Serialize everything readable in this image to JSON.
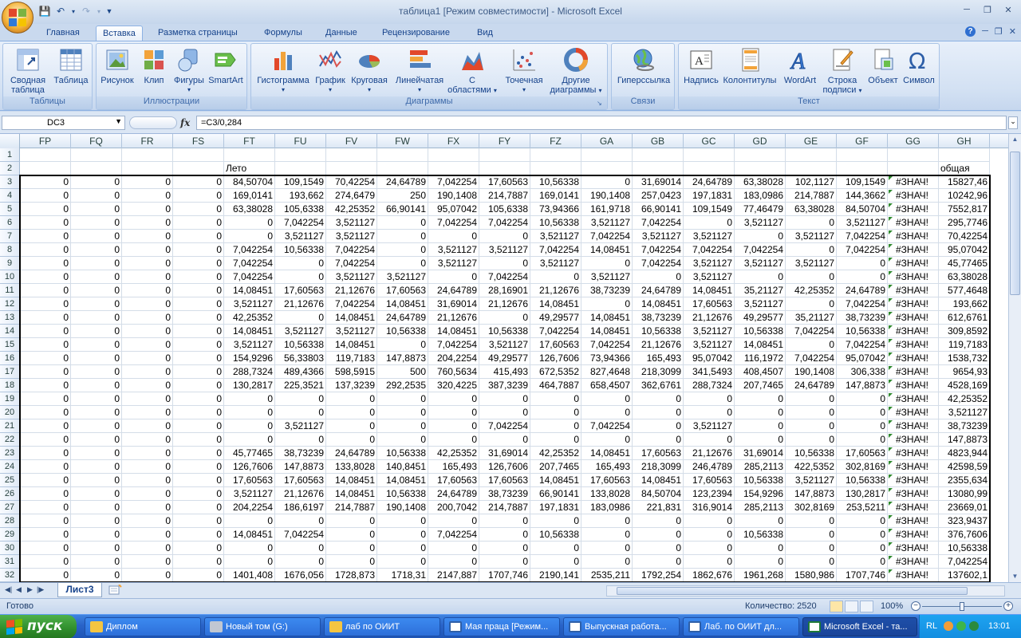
{
  "window": {
    "title": "таблица1  [Режим совместимости] - Microsoft Excel"
  },
  "ribbon_tabs": [
    "Главная",
    "Вставка",
    "Разметка страницы",
    "Формулы",
    "Данные",
    "Рецензирование",
    "Вид"
  ],
  "active_tab": "Вставка",
  "ribbon": {
    "groups": [
      {
        "label": "Таблицы",
        "buttons": [
          "Сводная таблица",
          "Таблица"
        ]
      },
      {
        "label": "Иллюстрации",
        "buttons": [
          "Рисунок",
          "Клип",
          "Фигуры",
          "SmartArt"
        ]
      },
      {
        "label": "Диаграммы",
        "buttons": [
          "Гистограмма",
          "График",
          "Круговая",
          "Линейчатая",
          "С областями",
          "Точечная",
          "Другие диаграммы"
        ]
      },
      {
        "label": "Связи",
        "buttons": [
          "Гиперссылка"
        ]
      },
      {
        "label": "Текст",
        "buttons": [
          "Надпись",
          "Колонтитулы",
          "WordArt",
          "Строка подписи",
          "Объект",
          "Символ"
        ]
      }
    ]
  },
  "formula_bar": {
    "name_box": "DC3",
    "fx": "fx",
    "formula": "=C3/0,284"
  },
  "sheet": {
    "columns": [
      "FP",
      "FQ",
      "FR",
      "FS",
      "FT",
      "FU",
      "FV",
      "FW",
      "FX",
      "FY",
      "FZ",
      "GA",
      "GB",
      "GC",
      "GD",
      "GE",
      "GF",
      "GG",
      "GH"
    ],
    "row2": {
      "FT": "Лето",
      "GH": "общая"
    },
    "rows": [
      {
        "n": "1",
        "c": [
          "",
          "",
          "",
          "",
          "",
          "",
          "",
          "",
          "",
          "",
          "",
          "",
          "",
          "",
          "",
          "",
          "",
          "",
          ""
        ]
      },
      {
        "n": "2",
        "c": [
          "",
          "",
          "",
          "",
          "Лето",
          "",
          "",
          "",
          "",
          "",
          "",
          "",
          "",
          "",
          "",
          "",
          "",
          "",
          "общая"
        ]
      },
      {
        "n": "3",
        "c": [
          "0",
          "0",
          "0",
          "0",
          "84,50704",
          "109,1549",
          "70,42254",
          "24,64789",
          "7,042254",
          "17,60563",
          "10,56338",
          "0",
          "31,69014",
          "24,64789",
          "63,38028",
          "102,1127",
          "109,1549",
          "#ЗНАЧ!",
          "15827,46"
        ]
      },
      {
        "n": "4",
        "c": [
          "0",
          "0",
          "0",
          "0",
          "169,0141",
          "193,662",
          "274,6479",
          "250",
          "190,1408",
          "214,7887",
          "169,0141",
          "190,1408",
          "257,0423",
          "197,1831",
          "183,0986",
          "214,7887",
          "144,3662",
          "#ЗНАЧ!",
          "10242,96"
        ]
      },
      {
        "n": "5",
        "c": [
          "0",
          "0",
          "0",
          "0",
          "63,38028",
          "105,6338",
          "42,25352",
          "66,90141",
          "95,07042",
          "105,6338",
          "73,94366",
          "161,9718",
          "66,90141",
          "109,1549",
          "77,46479",
          "63,38028",
          "84,50704",
          "#ЗНАЧ!",
          "7552,817"
        ]
      },
      {
        "n": "6",
        "c": [
          "0",
          "0",
          "0",
          "0",
          "0",
          "7,042254",
          "3,521127",
          "0",
          "7,042254",
          "7,042254",
          "10,56338",
          "3,521127",
          "7,042254",
          "0",
          "3,521127",
          "0",
          "3,521127",
          "#ЗНАЧ!",
          "295,7746"
        ]
      },
      {
        "n": "7",
        "c": [
          "0",
          "0",
          "0",
          "0",
          "0",
          "3,521127",
          "3,521127",
          "0",
          "0",
          "0",
          "3,521127",
          "7,042254",
          "3,521127",
          "3,521127",
          "0",
          "3,521127",
          "7,042254",
          "#ЗНАЧ!",
          "70,42254"
        ]
      },
      {
        "n": "8",
        "c": [
          "0",
          "0",
          "0",
          "0",
          "7,042254",
          "10,56338",
          "7,042254",
          "0",
          "3,521127",
          "3,521127",
          "7,042254",
          "14,08451",
          "7,042254",
          "7,042254",
          "7,042254",
          "0",
          "7,042254",
          "#ЗНАЧ!",
          "95,07042"
        ]
      },
      {
        "n": "9",
        "c": [
          "0",
          "0",
          "0",
          "0",
          "7,042254",
          "0",
          "7,042254",
          "0",
          "3,521127",
          "0",
          "3,521127",
          "0",
          "7,042254",
          "3,521127",
          "3,521127",
          "3,521127",
          "0",
          "#ЗНАЧ!",
          "45,77465"
        ]
      },
      {
        "n": "10",
        "c": [
          "0",
          "0",
          "0",
          "0",
          "7,042254",
          "0",
          "3,521127",
          "3,521127",
          "0",
          "7,042254",
          "0",
          "3,521127",
          "0",
          "3,521127",
          "0",
          "0",
          "0",
          "#ЗНАЧ!",
          "63,38028"
        ]
      },
      {
        "n": "11",
        "c": [
          "0",
          "0",
          "0",
          "0",
          "14,08451",
          "17,60563",
          "21,12676",
          "17,60563",
          "24,64789",
          "28,16901",
          "21,12676",
          "38,73239",
          "24,64789",
          "14,08451",
          "35,21127",
          "42,25352",
          "24,64789",
          "#ЗНАЧ!",
          "577,4648"
        ]
      },
      {
        "n": "12",
        "c": [
          "0",
          "0",
          "0",
          "0",
          "3,521127",
          "21,12676",
          "7,042254",
          "14,08451",
          "31,69014",
          "21,12676",
          "14,08451",
          "0",
          "14,08451",
          "17,60563",
          "3,521127",
          "0",
          "7,042254",
          "#ЗНАЧ!",
          "193,662"
        ]
      },
      {
        "n": "13",
        "c": [
          "0",
          "0",
          "0",
          "0",
          "42,25352",
          "0",
          "14,08451",
          "24,64789",
          "21,12676",
          "0",
          "49,29577",
          "14,08451",
          "38,73239",
          "21,12676",
          "49,29577",
          "35,21127",
          "38,73239",
          "#ЗНАЧ!",
          "612,6761"
        ]
      },
      {
        "n": "14",
        "c": [
          "0",
          "0",
          "0",
          "0",
          "14,08451",
          "3,521127",
          "3,521127",
          "10,56338",
          "14,08451",
          "10,56338",
          "7,042254",
          "14,08451",
          "10,56338",
          "3,521127",
          "10,56338",
          "7,042254",
          "10,56338",
          "#ЗНАЧ!",
          "309,8592"
        ]
      },
      {
        "n": "15",
        "c": [
          "0",
          "0",
          "0",
          "0",
          "3,521127",
          "10,56338",
          "14,08451",
          "0",
          "7,042254",
          "3,521127",
          "17,60563",
          "7,042254",
          "21,12676",
          "3,521127",
          "14,08451",
          "0",
          "7,042254",
          "#ЗНАЧ!",
          "119,7183"
        ]
      },
      {
        "n": "16",
        "c": [
          "0",
          "0",
          "0",
          "0",
          "154,9296",
          "56,33803",
          "119,7183",
          "147,8873",
          "204,2254",
          "49,29577",
          "126,7606",
          "73,94366",
          "165,493",
          "95,07042",
          "116,1972",
          "7,042254",
          "95,07042",
          "#ЗНАЧ!",
          "1538,732"
        ]
      },
      {
        "n": "17",
        "c": [
          "0",
          "0",
          "0",
          "0",
          "288,7324",
          "489,4366",
          "598,5915",
          "500",
          "760,5634",
          "415,493",
          "672,5352",
          "827,4648",
          "218,3099",
          "341,5493",
          "408,4507",
          "190,1408",
          "306,338",
          "#ЗНАЧ!",
          "9654,93"
        ]
      },
      {
        "n": "18",
        "c": [
          "0",
          "0",
          "0",
          "0",
          "130,2817",
          "225,3521",
          "137,3239",
          "292,2535",
          "320,4225",
          "387,3239",
          "464,7887",
          "658,4507",
          "362,6761",
          "288,7324",
          "207,7465",
          "24,64789",
          "147,8873",
          "#ЗНАЧ!",
          "4528,169"
        ]
      },
      {
        "n": "19",
        "c": [
          "0",
          "0",
          "0",
          "0",
          "0",
          "0",
          "0",
          "0",
          "0",
          "0",
          "0",
          "0",
          "0",
          "0",
          "0",
          "0",
          "0",
          "#ЗНАЧ!",
          "42,25352"
        ]
      },
      {
        "n": "20",
        "c": [
          "0",
          "0",
          "0",
          "0",
          "0",
          "0",
          "0",
          "0",
          "0",
          "0",
          "0",
          "0",
          "0",
          "0",
          "0",
          "0",
          "0",
          "#ЗНАЧ!",
          "3,521127"
        ]
      },
      {
        "n": "21",
        "c": [
          "0",
          "0",
          "0",
          "0",
          "0",
          "3,521127",
          "0",
          "0",
          "0",
          "7,042254",
          "0",
          "7,042254",
          "0",
          "3,521127",
          "0",
          "0",
          "0",
          "#ЗНАЧ!",
          "38,73239"
        ]
      },
      {
        "n": "22",
        "c": [
          "0",
          "0",
          "0",
          "0",
          "0",
          "0",
          "0",
          "0",
          "0",
          "0",
          "0",
          "0",
          "0",
          "0",
          "0",
          "0",
          "0",
          "#ЗНАЧ!",
          "147,8873"
        ]
      },
      {
        "n": "23",
        "c": [
          "0",
          "0",
          "0",
          "0",
          "45,77465",
          "38,73239",
          "24,64789",
          "10,56338",
          "42,25352",
          "31,69014",
          "42,25352",
          "14,08451",
          "17,60563",
          "21,12676",
          "31,69014",
          "10,56338",
          "17,60563",
          "#ЗНАЧ!",
          "4823,944"
        ]
      },
      {
        "n": "24",
        "c": [
          "0",
          "0",
          "0",
          "0",
          "126,7606",
          "147,8873",
          "133,8028",
          "140,8451",
          "165,493",
          "126,7606",
          "207,7465",
          "165,493",
          "218,3099",
          "246,4789",
          "285,2113",
          "422,5352",
          "302,8169",
          "#ЗНАЧ!",
          "42598,59"
        ]
      },
      {
        "n": "25",
        "c": [
          "0",
          "0",
          "0",
          "0",
          "17,60563",
          "17,60563",
          "14,08451",
          "14,08451",
          "17,60563",
          "17,60563",
          "14,08451",
          "17,60563",
          "14,08451",
          "17,60563",
          "10,56338",
          "3,521127",
          "10,56338",
          "#ЗНАЧ!",
          "2355,634"
        ]
      },
      {
        "n": "26",
        "c": [
          "0",
          "0",
          "0",
          "0",
          "3,521127",
          "21,12676",
          "14,08451",
          "10,56338",
          "24,64789",
          "38,73239",
          "66,90141",
          "133,8028",
          "84,50704",
          "123,2394",
          "154,9296",
          "147,8873",
          "130,2817",
          "#ЗНАЧ!",
          "13080,99"
        ]
      },
      {
        "n": "27",
        "c": [
          "0",
          "0",
          "0",
          "0",
          "204,2254",
          "186,6197",
          "214,7887",
          "190,1408",
          "200,7042",
          "214,7887",
          "197,1831",
          "183,0986",
          "221,831",
          "316,9014",
          "285,2113",
          "302,8169",
          "253,5211",
          "#ЗНАЧ!",
          "23669,01"
        ]
      },
      {
        "n": "28",
        "c": [
          "0",
          "0",
          "0",
          "0",
          "0",
          "0",
          "0",
          "0",
          "0",
          "0",
          "0",
          "0",
          "0",
          "0",
          "0",
          "0",
          "0",
          "#ЗНАЧ!",
          "323,9437"
        ]
      },
      {
        "n": "29",
        "c": [
          "0",
          "0",
          "0",
          "0",
          "14,08451",
          "7,042254",
          "0",
          "0",
          "7,042254",
          "0",
          "10,56338",
          "0",
          "0",
          "0",
          "10,56338",
          "0",
          "0",
          "#ЗНАЧ!",
          "376,7606"
        ]
      },
      {
        "n": "30",
        "c": [
          "0",
          "0",
          "0",
          "0",
          "0",
          "0",
          "0",
          "0",
          "0",
          "0",
          "0",
          "0",
          "0",
          "0",
          "0",
          "0",
          "0",
          "#ЗНАЧ!",
          "10,56338"
        ]
      },
      {
        "n": "31",
        "c": [
          "0",
          "0",
          "0",
          "0",
          "0",
          "0",
          "0",
          "0",
          "0",
          "0",
          "0",
          "0",
          "0",
          "0",
          "0",
          "0",
          "0",
          "#ЗНАЧ!",
          "7,042254"
        ]
      },
      {
        "n": "32",
        "c": [
          "0",
          "0",
          "0",
          "0",
          "1401,408",
          "1676,056",
          "1728,873",
          "1718,31",
          "2147,887",
          "1707,746",
          "2190,141",
          "2535,211",
          "1792,254",
          "1862,676",
          "1961,268",
          "1580,986",
          "1707,746",
          "#ЗНАЧ!",
          "137602,1"
        ]
      }
    ]
  },
  "sheet_tabs": {
    "active": "Лист3"
  },
  "status": {
    "ready": "Готово",
    "count": "Количество: 2520",
    "zoom": "100%",
    "zoom_level_percent": 100,
    "zoom_minus": "−",
    "zoom_plus": "+"
  },
  "taskbar": {
    "start": "пуск",
    "tasks": [
      "Диплом",
      "Новый том (G:)",
      "лаб по ОИИТ",
      "Мая праца [Режим...",
      "Выпускная работа...",
      "Лаб. по ОИИТ дл...",
      "Microsoft Excel - та..."
    ],
    "active_task": "Microsoft Excel - та...",
    "lang": "RL",
    "time": "13:01"
  },
  "colors": {
    "ribbon_text": "#15428b",
    "error_triangle": "#2f8a2f",
    "taskbar_blue": "#2963c8",
    "start_green": "#2f8d2c"
  }
}
